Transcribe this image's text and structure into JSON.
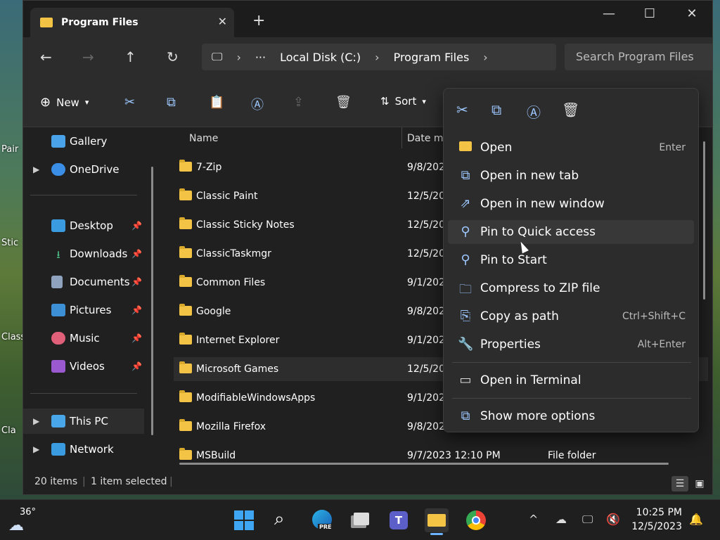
{
  "desktop": {
    "icons": [
      {
        "label": "Pair"
      },
      {
        "label": "Stic"
      },
      {
        "label": "Class"
      },
      {
        "label": "Cla"
      }
    ]
  },
  "window": {
    "tab_title": "Program Files",
    "address": {
      "items": [
        "Local Disk (C:)",
        "Program Files"
      ]
    },
    "search_placeholder": "Search Program Files"
  },
  "toolbar": {
    "new_label": "New",
    "sort_label": "Sort"
  },
  "sidebar": {
    "items": [
      {
        "label": "Gallery"
      },
      {
        "label": "OneDrive"
      },
      {
        "label": "Desktop"
      },
      {
        "label": "Downloads"
      },
      {
        "label": "Documents"
      },
      {
        "label": "Pictures"
      },
      {
        "label": "Music"
      },
      {
        "label": "Videos"
      },
      {
        "label": "This PC"
      },
      {
        "label": "Network"
      }
    ]
  },
  "filelist": {
    "headers": {
      "name": "Name",
      "date": "Date mo"
    },
    "rows": [
      {
        "name": "7-Zip",
        "date": "9/8/202"
      },
      {
        "name": "Classic Paint",
        "date": "12/5/20"
      },
      {
        "name": "Classic Sticky Notes",
        "date": "12/5/20"
      },
      {
        "name": "ClassicTaskmgr",
        "date": "12/5/20"
      },
      {
        "name": "Common Files",
        "date": "9/1/202"
      },
      {
        "name": "Google",
        "date": "9/8/202"
      },
      {
        "name": "Internet Explorer",
        "date": "9/1/202"
      },
      {
        "name": "Microsoft Games",
        "date": "12/5/20"
      },
      {
        "name": "ModifiableWindowsApps",
        "date": "9/1/202"
      },
      {
        "name": "Mozilla Firefox",
        "date": "9/8/202"
      },
      {
        "name": "MSBuild",
        "date": "9/7/2023 12:10 PM",
        "type": "File folder"
      }
    ]
  },
  "status": {
    "items_count": "20 items",
    "selected": "1 item selected"
  },
  "context_menu": {
    "items": [
      {
        "label": "Open",
        "shortcut": "Enter"
      },
      {
        "label": "Open in new tab",
        "shortcut": ""
      },
      {
        "label": "Open in new window",
        "shortcut": ""
      },
      {
        "label": "Pin to Quick access",
        "shortcut": ""
      },
      {
        "label": "Pin to Start",
        "shortcut": ""
      },
      {
        "label": "Compress to ZIP file",
        "shortcut": ""
      },
      {
        "label": "Copy as path",
        "shortcut": "Ctrl+Shift+C"
      },
      {
        "label": "Properties",
        "shortcut": "Alt+Enter"
      },
      {
        "label": "Open in Terminal",
        "shortcut": ""
      },
      {
        "label": "Show more options",
        "shortcut": ""
      }
    ]
  },
  "taskbar": {
    "weather": "36°",
    "time": "10:25 PM",
    "date": "12/5/2023",
    "pre_badge": "PRE"
  },
  "colors": {
    "accent": "#9cc7ff",
    "folder": "#f2c344",
    "window_bg": "#202020"
  }
}
